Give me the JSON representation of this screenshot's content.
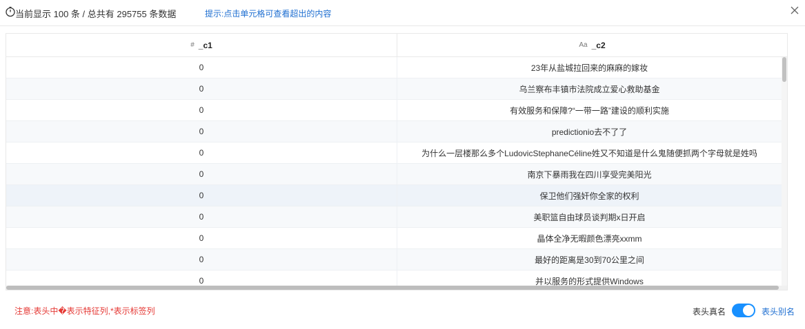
{
  "header": {
    "summary": "当前显示 100 条 / 总共有 295755 条数据",
    "hint": "提示:点击单元格可查看超出的内容"
  },
  "table": {
    "columns": [
      {
        "type_icon": "#",
        "name": "_c1"
      },
      {
        "type_icon": "Aa",
        "name": "_c2"
      }
    ],
    "rows": [
      {
        "c1": "0",
        "c2": "23年从盐城拉回来的麻麻的嫁妆"
      },
      {
        "c1": "0",
        "c2": "乌兰察布丰镇市法院成立爱心救助基金"
      },
      {
        "c1": "0",
        "c2": "有效服务和保障?“一带一路”建设的顺利实施"
      },
      {
        "c1": "0",
        "c2": "predictionio去不了了"
      },
      {
        "c1": "0",
        "c2": "为什么一层楼那么多个LudovicStephaneCéline姓又不知道是什么鬼随便抓两个字母就是姓吗"
      },
      {
        "c1": "0",
        "c2": "南京下暴雨我在四川享受完美阳光"
      },
      {
        "c1": "0",
        "c2": "保卫他们强奸你全家的权利"
      },
      {
        "c1": "0",
        "c2": "美职篮自由球员谈判期x日开启"
      },
      {
        "c1": "0",
        "c2": "晶体全净无暇颜色漂亮xxmm"
      },
      {
        "c1": "0",
        "c2": "最好的距离是30到70公里之间"
      },
      {
        "c1": "0",
        "c2": "并以服务的形式提供Windows"
      }
    ]
  },
  "footer": {
    "note": "注意:表头中�表示特征列,*表示标签列",
    "label_real": "表头真名",
    "label_alias": "表头别名",
    "toggle_on": true
  },
  "colors": {
    "accent": "#1890ff",
    "link": "#1f6fd1",
    "warning": "#e53935"
  }
}
